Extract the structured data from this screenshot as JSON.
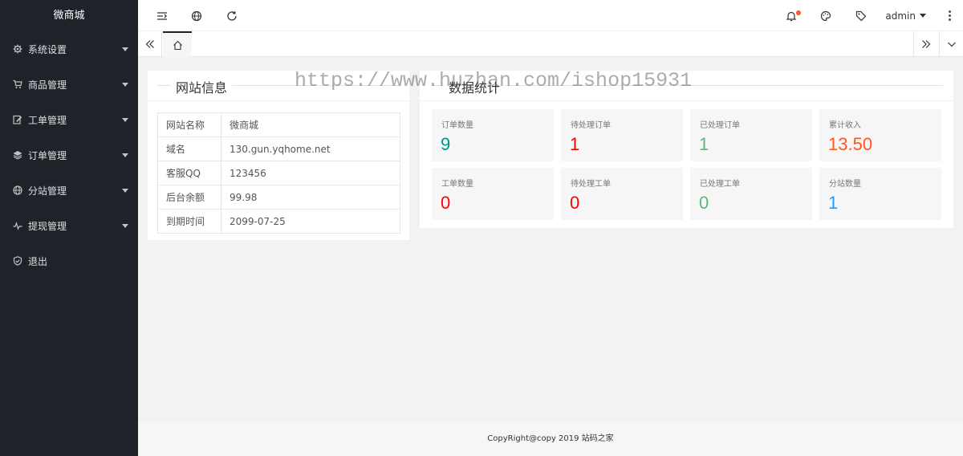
{
  "app": {
    "brand": "微商城"
  },
  "sidebar": {
    "items": [
      {
        "label": "系统设置",
        "icon": "gear-icon",
        "has_arrow": true
      },
      {
        "label": "商品管理",
        "icon": "cart-icon",
        "has_arrow": true
      },
      {
        "label": "工单管理",
        "icon": "edit-icon",
        "has_arrow": true
      },
      {
        "label": "订单管理",
        "icon": "layers-icon",
        "has_arrow": true
      },
      {
        "label": "分站管理",
        "icon": "globe-icon",
        "has_arrow": true
      },
      {
        "label": "提现管理",
        "icon": "pulse-icon",
        "has_arrow": true
      },
      {
        "label": "退出",
        "icon": "shield-icon",
        "has_arrow": false
      }
    ]
  },
  "header": {
    "icons": [
      "menu-toggle-icon",
      "globe-icon",
      "refresh-icon",
      "bell-icon",
      "theme-icon",
      "tag-icon"
    ],
    "user": "admin",
    "notification_color": "#ff5722"
  },
  "site_info": {
    "title": "网站信息",
    "rows": [
      {
        "key": "网站名称",
        "value": "微商城"
      },
      {
        "key": "域名",
        "value": "130.gun.yqhome.net"
      },
      {
        "key": "客服QQ",
        "value": "123456"
      },
      {
        "key": "后台余额",
        "value": "99.98"
      },
      {
        "key": "到期时间",
        "value": "2099-07-25"
      }
    ]
  },
  "stats": {
    "title": "数据统计",
    "items": [
      {
        "label": "订单数量",
        "value": "9",
        "color": "#009688"
      },
      {
        "label": "待处理订单",
        "value": "1",
        "color": "#ff0000"
      },
      {
        "label": "已处理订单",
        "value": "1",
        "color": "#5fb878"
      },
      {
        "label": "累计收入",
        "value": "13.50",
        "color": "#ff5722"
      },
      {
        "label": "工单数量",
        "value": "0",
        "color": "#ff0000"
      },
      {
        "label": "待处理工单",
        "value": "0",
        "color": "#ff0000"
      },
      {
        "label": "已处理工单",
        "value": "0",
        "color": "#5fb878"
      },
      {
        "label": "分站数量",
        "value": "1",
        "color": "#1e9fff"
      }
    ]
  },
  "watermark": "https://www.huzhan.com/ishop15931",
  "footer": {
    "text": "CopyRight@copy 2019 站码之家"
  }
}
